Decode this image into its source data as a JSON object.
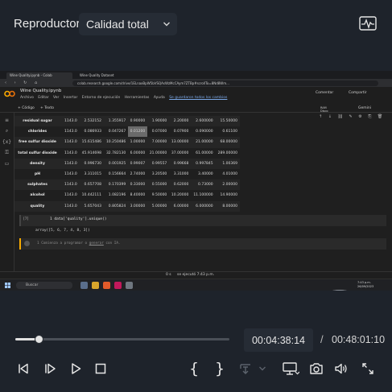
{
  "header": {
    "title": "Reproductor",
    "quality_label": "Calidad total"
  },
  "video": {
    "browser": {
      "tabs": [
        "Wine Quality.ipynb - Colab",
        "Wine Quality Dataset"
      ],
      "url": "colab.research.google.com/drive/1ELnaxBpW5bVSQAsWzMcCAym7ZTBp#scrollTo=8Nd8Wm..."
    },
    "colab": {
      "notebook_name": "Wine Quality.ipynb",
      "menus": [
        "Archivo",
        "Editar",
        "Ver",
        "Insertar",
        "Entorno de ejecución",
        "Herramientas",
        "Ayuda"
      ],
      "saved_notice": "Se guardaron todos los cambios",
      "comment_label": "Comentar",
      "share_label": "Compartir",
      "add_code_label": "+ Código",
      "add_text_label": "+ Texto",
      "ram_label": "RAM",
      "disk_label": "Disco",
      "edit_label": "Gemini"
    },
    "describe_table": {
      "rows": [
        [
          "residual sugar",
          "1143.0",
          "2.532152",
          "1.355917",
          "0.90000",
          "1.90000",
          "2.20000",
          "2.600000",
          "15.50000"
        ],
        [
          "chlorides",
          "1143.0",
          "0.086933",
          "0.047267",
          "0.01200",
          "0.07000",
          "0.07900",
          "0.090000",
          "0.61100"
        ],
        [
          "free sulfur dioxide",
          "1143.0",
          "15.615486",
          "10.250486",
          "1.00000",
          "7.00000",
          "13.00000",
          "21.00000",
          "68.00000"
        ],
        [
          "total sulfur dioxide",
          "1143.0",
          "45.914698",
          "32.782130",
          "6.00000",
          "21.00000",
          "37.00000",
          "61.00000",
          "289.00000"
        ],
        [
          "density",
          "1143.0",
          "0.996730",
          "0.001925",
          "0.99007",
          "0.99557",
          "0.99668",
          "0.997845",
          "1.00369"
        ],
        [
          "pH",
          "1143.0",
          "3.311015",
          "0.156664",
          "2.74000",
          "3.20500",
          "3.31000",
          "3.40000",
          "4.01000"
        ],
        [
          "sulphates",
          "1143.0",
          "0.657708",
          "0.170399",
          "0.33000",
          "0.55000",
          "0.62000",
          "0.73000",
          "2.00000"
        ],
        [
          "alcohol",
          "1143.0",
          "10.442111",
          "1.082196",
          "8.40000",
          "9.50000",
          "10.20000",
          "11.100000",
          "14.90000"
        ],
        [
          "quality",
          "1143.0",
          "5.657043",
          "0.805824",
          "3.00000",
          "5.00000",
          "6.00000",
          "6.000000",
          "8.00000"
        ]
      ]
    },
    "code_cell": {
      "number": "[7]",
      "code": "1 data['quality'].unique()",
      "output": "array([5, 6, 7, 4, 8, 3])"
    },
    "empty_cell": {
      "hint_prefix": "1 ",
      "hint": "Comienza a programar o ",
      "hint_link": "generar",
      "hint_suffix": " con IA."
    },
    "status": {
      "exec_time": "0 s",
      "exec_text": "se ejecutó 7:43 p.m."
    },
    "taskbar": {
      "search_label": "Buscar",
      "time": "7:43 p.m.",
      "date": "26/09/2023"
    }
  },
  "player": {
    "progress": 0.1137,
    "current_time": "00:04:38:14",
    "separator": "/",
    "total_time": "00:48:01:10",
    "open_brace": "{",
    "close_brace": "}"
  }
}
